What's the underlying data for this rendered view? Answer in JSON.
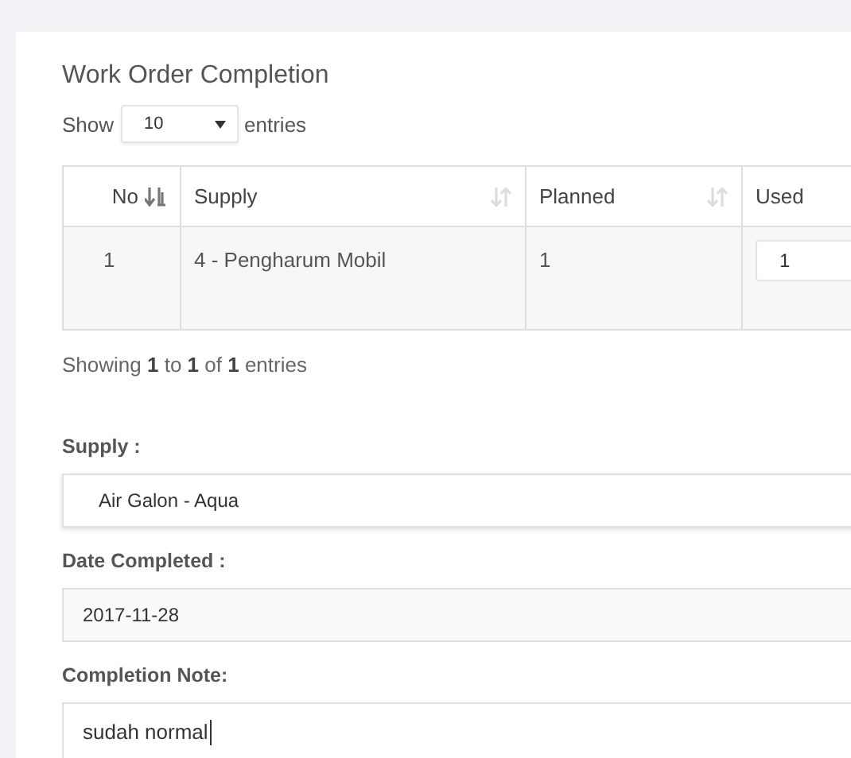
{
  "title": "Work Order Completion",
  "length_menu": {
    "before": "Show",
    "value": "10",
    "after": "entries"
  },
  "table": {
    "columns": [
      {
        "label": "No",
        "sorted": true
      },
      {
        "label": "Supply",
        "sorted": false
      },
      {
        "label": "Planned",
        "sorted": false
      },
      {
        "label": "Used"
      }
    ],
    "rows": [
      {
        "no": "1",
        "supply": "4 - Pengharum Mobil",
        "planned": "1",
        "used": "1"
      }
    ]
  },
  "info": "Showing **1** to **1** of **1** entries",
  "form": [
    {
      "label": "Supply :",
      "kind": "select",
      "value": "Air Galon - Aqua"
    },
    {
      "label": "Date Completed :",
      "kind": "date",
      "value": "2017-11-28"
    },
    {
      "label": "Completion Note:",
      "kind": "textarea",
      "value": "sudah normal"
    }
  ]
}
